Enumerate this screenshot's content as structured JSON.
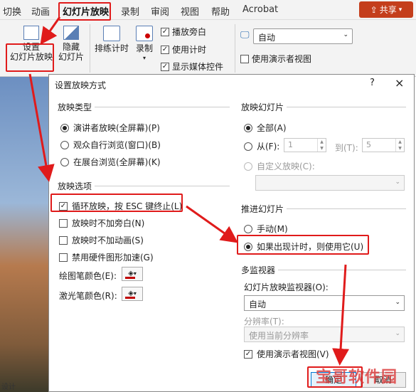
{
  "ribbon": {
    "tabs": [
      "切换",
      "动画",
      "幻灯片放映",
      "录制",
      "审阅",
      "视图",
      "帮助",
      "Acrobat"
    ],
    "active_tab": "幻灯片放映",
    "share_label": "共享",
    "buttons": {
      "setup_line1": "设置",
      "setup_line2": "幻灯片放映",
      "hide_line1": "隐藏",
      "hide_line2": "幻灯片",
      "rehearse": "排练计时",
      "record": "录制"
    },
    "checks": {
      "play_narration": "播放旁白",
      "use_timings": "使用计时",
      "show_media_controls": "显示媒体控件",
      "use_presenter_view": "使用演示者视图"
    },
    "monitor_select": "自动"
  },
  "dialog": {
    "title": "设置放映方式",
    "help": "?",
    "close": "×",
    "show_type": {
      "label": "放映类型",
      "options": [
        "演讲者放映(全屏幕)(P)",
        "观众自行浏览(窗口)(B)",
        "在展台浏览(全屏幕)(K)"
      ]
    },
    "show_options": {
      "label": "放映选项",
      "items": [
        "循环放映，按 ESC 键终止(L)",
        "放映时不加旁白(N)",
        "放映时不加动画(S)",
        "禁用硬件图形加速(G)"
      ],
      "pen_color": "绘图笔颜色(E):",
      "laser_color": "激光笔颜色(R):"
    },
    "show_slides": {
      "label": "放映幻灯片",
      "all": "全部(A)",
      "from": "从(F):",
      "from_value": "1",
      "to": "到(T):",
      "to_value": "5",
      "custom": "自定义放映(C):"
    },
    "advance": {
      "label": "推进幻灯片",
      "manual": "手动(M)",
      "timings": "如果出现计时，则使用它(U)"
    },
    "monitors": {
      "label": "多监视器",
      "monitor_label": "幻灯片放映监视器(O):",
      "monitor_value": "自动",
      "resolution_label": "分辨率(T):",
      "resolution_value": "使用当前分辨率",
      "presenter_view": "使用演示者视图(V)"
    },
    "ok": "确定",
    "cancel": "取消"
  },
  "status_text": "设计",
  "watermark": "宝哥软件园",
  "colors": {
    "highlight": "#e01b1b",
    "share": "#c43e1c",
    "pen": "#c00000"
  }
}
